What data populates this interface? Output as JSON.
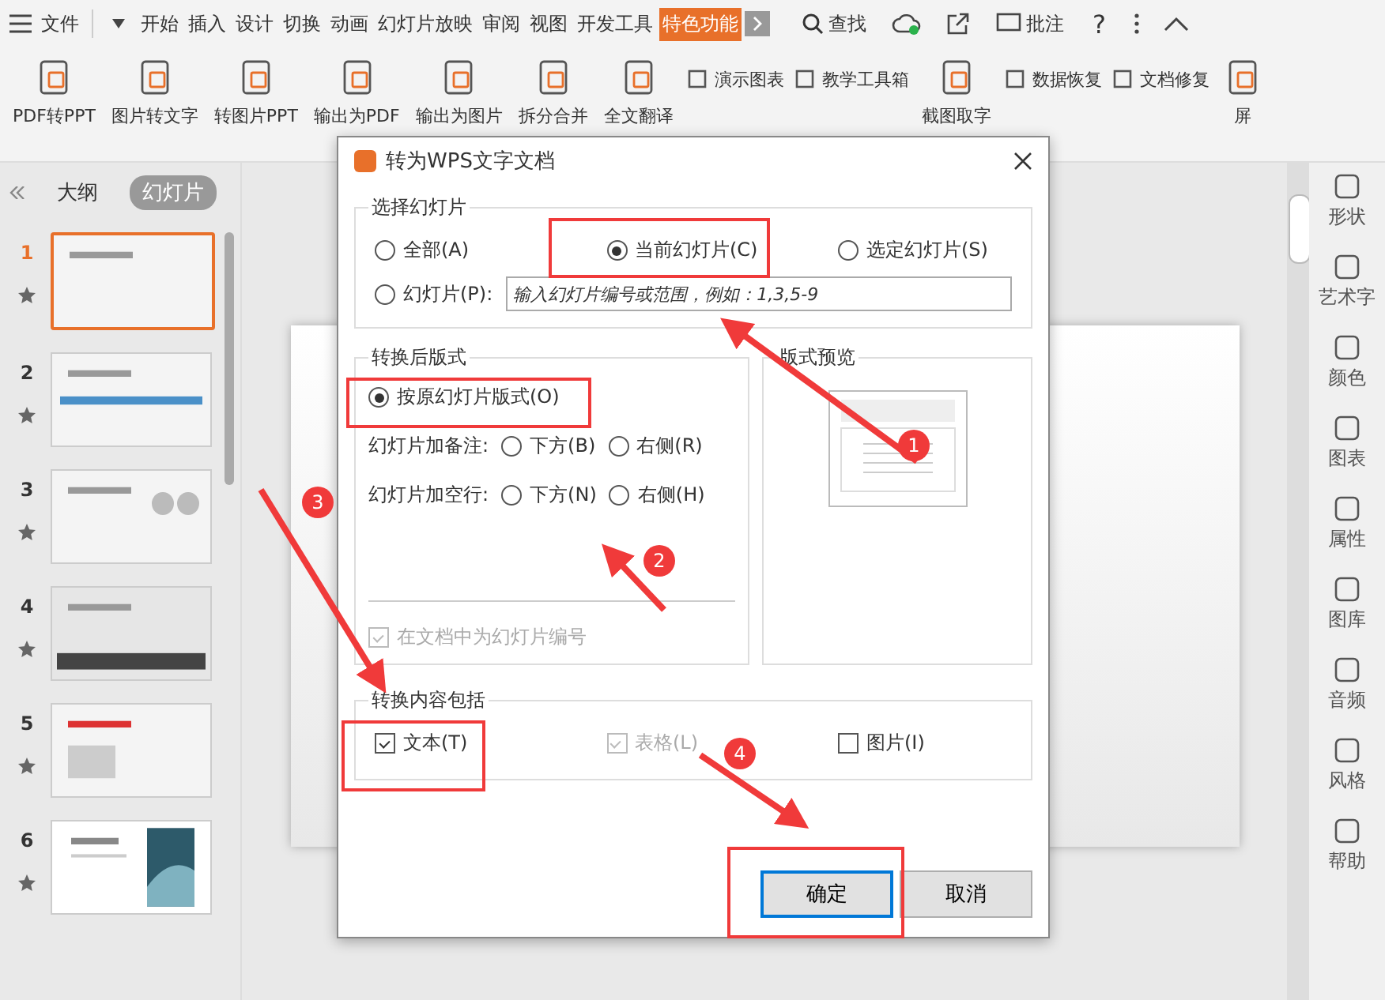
{
  "menu": {
    "file": "文件",
    "tabs": [
      {
        "label": "开始",
        "selected": false
      },
      {
        "label": "插入",
        "selected": false
      },
      {
        "label": "设计",
        "selected": false
      },
      {
        "label": "切换",
        "selected": false
      },
      {
        "label": "动画",
        "selected": false
      },
      {
        "label": "幻灯片放映",
        "selected": false
      },
      {
        "label": "审阅",
        "selected": false
      },
      {
        "label": "视图",
        "selected": false
      },
      {
        "label": "开发工具",
        "selected": false
      },
      {
        "label": "特色功能",
        "selected": true
      }
    ],
    "search": "查找",
    "comment": "批注",
    "help": "?"
  },
  "ribbon": {
    "items": [
      {
        "label": "PDF转PPT",
        "kind": "large"
      },
      {
        "label": "图片转文字",
        "kind": "large"
      },
      {
        "label": "转图片PPT",
        "kind": "large"
      },
      {
        "label": "输出为PDF",
        "kind": "large"
      },
      {
        "label": "输出为图片",
        "kind": "large"
      },
      {
        "label": "拆分合并",
        "kind": "large"
      },
      {
        "label": "全文翻译",
        "kind": "large"
      },
      {
        "label": "演示图表",
        "kind": "small"
      },
      {
        "label": "教学工具箱",
        "kind": "small"
      },
      {
        "label": "截图取字",
        "kind": "large"
      },
      {
        "label": "数据恢复",
        "kind": "small"
      },
      {
        "label": "文档修复",
        "kind": "small"
      },
      {
        "label": "屏",
        "kind": "large"
      }
    ]
  },
  "panel": {
    "tabs": [
      {
        "label": "大纲",
        "selected": false
      },
      {
        "label": "幻灯片",
        "selected": true
      }
    ],
    "slides": [
      {
        "number": "1",
        "selected": true
      },
      {
        "number": "2",
        "selected": false
      },
      {
        "number": "3",
        "selected": false
      },
      {
        "number": "4",
        "selected": false
      },
      {
        "number": "5",
        "selected": false
      },
      {
        "number": "6",
        "selected": false
      }
    ]
  },
  "sidebar": {
    "items": [
      {
        "label": "形状"
      },
      {
        "label": "艺术字"
      },
      {
        "label": "颜色"
      },
      {
        "label": "图表"
      },
      {
        "label": "属性"
      },
      {
        "label": "图库"
      },
      {
        "label": "音频"
      },
      {
        "label": "风格"
      },
      {
        "label": "帮助"
      }
    ]
  },
  "dialog": {
    "title": "转为WPS文字文档",
    "select_group": {
      "title": "选择幻灯片",
      "options": [
        {
          "label": "全部(A)",
          "selected": false
        },
        {
          "label": "当前幻灯片(C)",
          "selected": true
        },
        {
          "label": "选定幻灯片(S)",
          "selected": false
        },
        {
          "label": "幻灯片(P):",
          "selected": false
        }
      ],
      "range_placeholder": "输入幻灯片编号或范围，例如：1,3,5-9"
    },
    "layout_group": {
      "title": "转换后版式",
      "original": {
        "label": "按原幻灯片版式(O)",
        "selected": true
      },
      "rows": [
        {
          "label": "幻灯片加备注:",
          "options": [
            {
              "label": "下方(B)",
              "selected": false
            },
            {
              "label": "右侧(R)",
              "selected": false
            }
          ]
        },
        {
          "label": "幻灯片加空行:",
          "options": [
            {
              "label": "下方(N)",
              "selected": false
            },
            {
              "label": "右侧(H)",
              "selected": false
            }
          ]
        }
      ],
      "numbering": {
        "label": "在文档中为幻灯片编号",
        "checked": true,
        "disabled": true
      }
    },
    "preview": {
      "title": "版式预览"
    },
    "content_group": {
      "title": "转换内容包括",
      "items": [
        {
          "label": "文本(T)",
          "checked": true,
          "disabled": false
        },
        {
          "label": "表格(L)",
          "checked": true,
          "disabled": true
        },
        {
          "label": "图片(I)",
          "checked": false,
          "disabled": false
        }
      ]
    },
    "buttons": [
      {
        "label": "确定",
        "default": true
      },
      {
        "label": "取消",
        "default": false
      }
    ]
  },
  "annotations": [
    "1",
    "2",
    "3",
    "4"
  ]
}
